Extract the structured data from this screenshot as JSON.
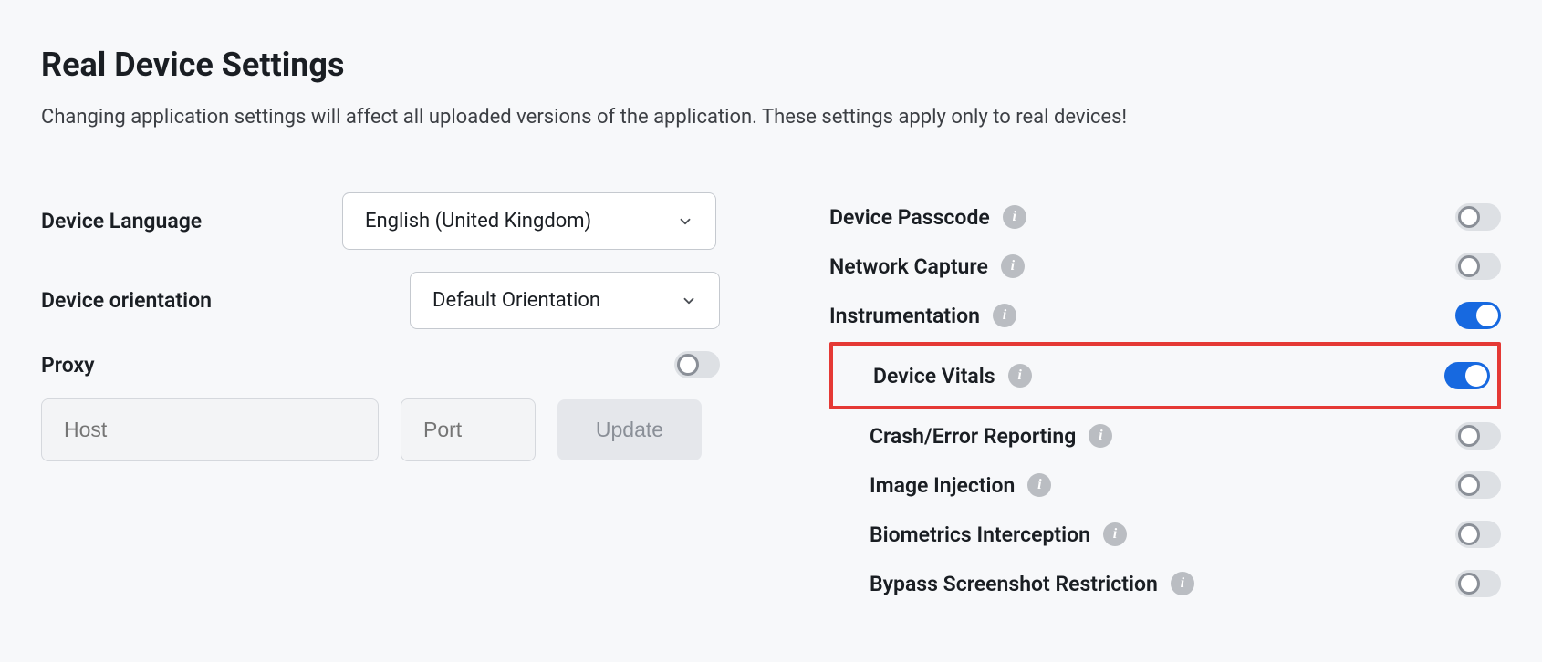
{
  "page": {
    "title": "Real Device Settings",
    "subtitle": "Changing application settings will affect all uploaded versions of the application. These settings apply only to real devices!"
  },
  "left": {
    "device_language": {
      "label": "Device Language",
      "value": "English (United Kingdom)"
    },
    "device_orientation": {
      "label": "Device orientation",
      "value": "Default Orientation"
    },
    "proxy": {
      "label": "Proxy",
      "host_placeholder": "Host",
      "port_placeholder": "Port",
      "update_label": "Update",
      "enabled": false
    }
  },
  "right": {
    "items": [
      {
        "label": "Device Passcode",
        "enabled": false,
        "indented": false,
        "highlighted": false
      },
      {
        "label": "Network Capture",
        "enabled": false,
        "indented": false,
        "highlighted": false
      },
      {
        "label": "Instrumentation",
        "enabled": true,
        "indented": false,
        "highlighted": false
      },
      {
        "label": "Device Vitals",
        "enabled": true,
        "indented": true,
        "highlighted": true
      },
      {
        "label": "Crash/Error Reporting",
        "enabled": false,
        "indented": true,
        "highlighted": false
      },
      {
        "label": "Image Injection",
        "enabled": false,
        "indented": true,
        "highlighted": false
      },
      {
        "label": "Biometrics Interception",
        "enabled": false,
        "indented": true,
        "highlighted": false
      },
      {
        "label": "Bypass Screenshot Restriction",
        "enabled": false,
        "indented": true,
        "highlighted": false
      }
    ]
  }
}
